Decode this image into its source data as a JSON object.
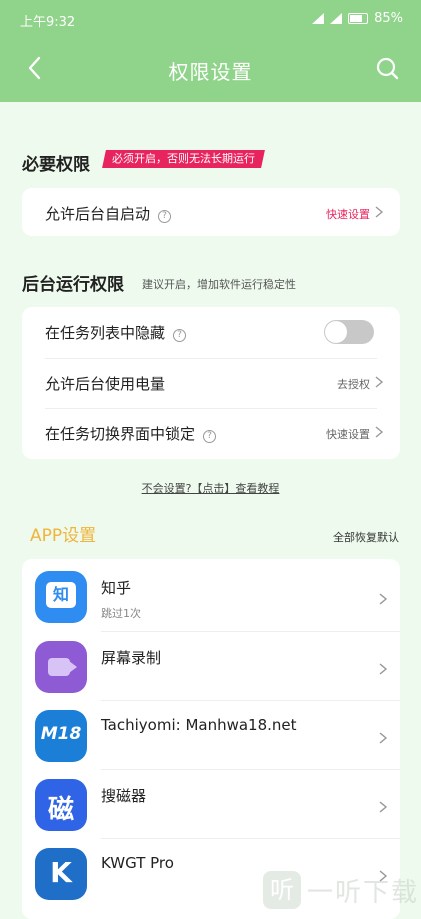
{
  "status": {
    "time": "上午9:32",
    "battery": "85%"
  },
  "nav": {
    "title": "权限设置",
    "back_icon": "chevron-left-icon",
    "search_icon": "search-icon"
  },
  "required": {
    "title": "必要权限",
    "tag": "必须开启，否则无法长期运行",
    "items": [
      {
        "label": "允许后台自启动",
        "value": "快速设置"
      }
    ]
  },
  "background": {
    "title": "后台运行权限",
    "subtitle": "建议开启，增加软件运行稳定性",
    "items": [
      {
        "label": "在任务列表中隐藏",
        "value": ""
      },
      {
        "label": "允许后台使用电量",
        "value": "去授权"
      },
      {
        "label": "在任务切换界面中锁定",
        "value": "快速设置"
      }
    ]
  },
  "tutorial": "不会设置?【点击】查看教程",
  "apps": {
    "title": "APP设置",
    "reset": "全部恢复默认",
    "items": [
      {
        "name": "知乎",
        "sub": "跳过1次",
        "icon_text": "知",
        "color": "#2f8cf0"
      },
      {
        "name": "屏幕录制",
        "sub": "",
        "icon_text": "",
        "color": "#8e5bd4"
      },
      {
        "name": "Tachiyomi: Manhwa18.net",
        "sub": "",
        "icon_text": "M18",
        "color": "#1b7fd8"
      },
      {
        "name": "搜磁器",
        "sub": "",
        "icon_text": "磁",
        "color": "#2f64e6"
      },
      {
        "name": "KWGT Pro",
        "sub": "",
        "icon_text": "K",
        "color": "#1f6fc9"
      }
    ]
  },
  "watermark": {
    "box": "听",
    "text": "一听下载"
  }
}
